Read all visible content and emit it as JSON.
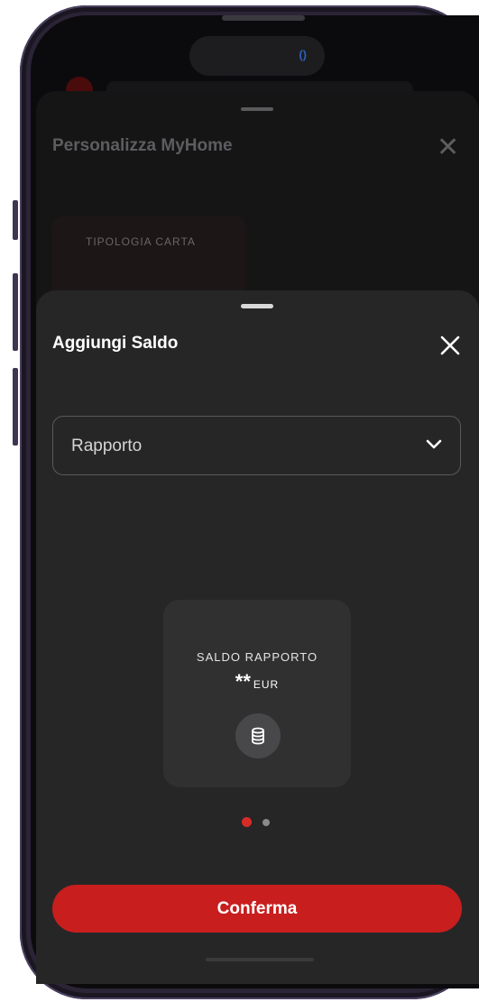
{
  "background_sheet": {
    "title": "Personalizza MyHome",
    "card_label": "TIPOLOGIA CARTA"
  },
  "sheet": {
    "title": "Aggiungi Saldo",
    "select": {
      "value": "Rapporto"
    },
    "balance_card": {
      "label": "SALDO RAPPORTO",
      "amount": "**",
      "currency": "EUR",
      "icon": "coins-icon"
    },
    "pagination": {
      "pages": 2,
      "active": 1
    },
    "confirm_label": "Conferma"
  },
  "colors": {
    "accent": "#c81e1e",
    "sheet_bg": "#262627",
    "card_bg": "#303031"
  }
}
